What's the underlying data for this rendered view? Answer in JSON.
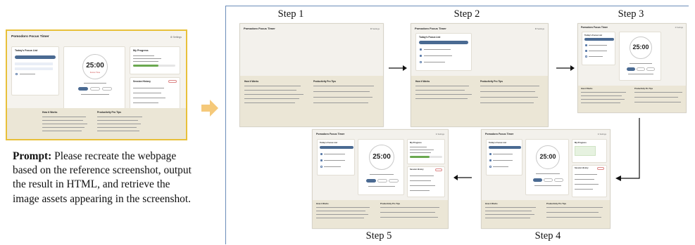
{
  "prompt": {
    "label": "Prompt:",
    "text": " Please recreate the webpage based on the reference screenshot, output the result in HTML, and retrieve the image assets appearing in the screenshot."
  },
  "steps": [
    {
      "label": "Step 1"
    },
    {
      "label": "Step 2"
    },
    {
      "label": "Step 3"
    },
    {
      "label": "Step 4"
    },
    {
      "label": "Step 5"
    }
  ],
  "app": {
    "title": "Pomodoro Focus Timer",
    "settings": "⚙ Settings",
    "focus_list_title": "Today's Focus List",
    "add_task": "+ Add New Task",
    "timer": "25:00",
    "phase": "Focus Time",
    "progress_title": "My Progress",
    "history_title": "Session History",
    "how_title": "How it Works",
    "tips_title": "Productivity Pro Tips"
  },
  "colors": {
    "accent": "#4a6a92",
    "highlight_border": "#e8c03a",
    "arrow_orange": "#f5c97a",
    "frame_blue": "#6a8cb8",
    "progress_green": "#6aa84f"
  }
}
